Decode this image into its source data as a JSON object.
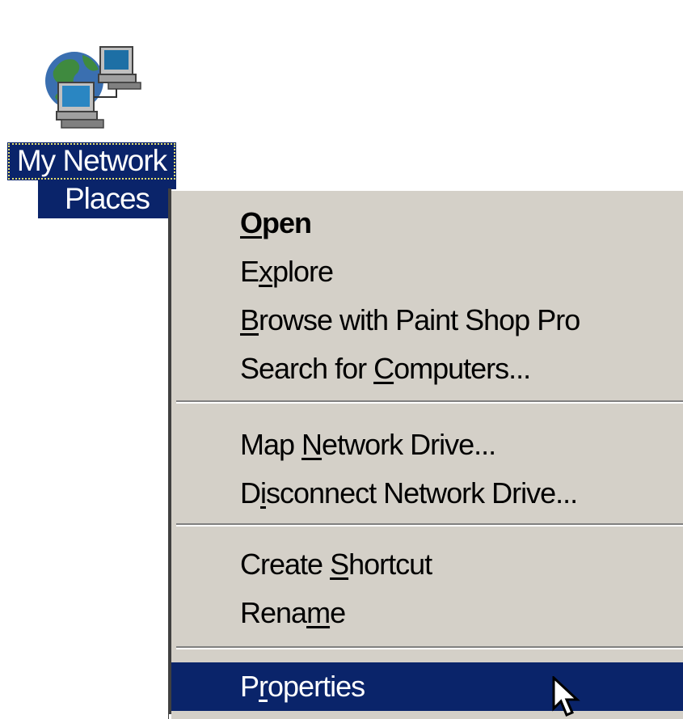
{
  "desktop_icon": {
    "name": "network-places-icon",
    "label_line_1": "My Network",
    "label_line_2": "Places"
  },
  "context_menu": {
    "items": [
      {
        "before": "",
        "accel": "O",
        "after": "pen",
        "bold": true
      },
      {
        "before": "E",
        "accel": "x",
        "after": "plore"
      },
      {
        "before": "",
        "accel": "B",
        "after": "rowse with Paint Shop Pro"
      },
      {
        "before": "Search for ",
        "accel": "C",
        "after": "omputers..."
      },
      {
        "before": "Map ",
        "accel": "N",
        "after": "etwork Drive..."
      },
      {
        "before": "D",
        "accel": "i",
        "after": "sconnect Network Drive..."
      },
      {
        "before": "Create ",
        "accel": "S",
        "after": "hortcut"
      },
      {
        "before": "Rena",
        "accel": "m",
        "after": "e"
      },
      {
        "before": "P",
        "accel": "r",
        "after": "operties",
        "selected": true
      }
    ]
  },
  "colors": {
    "selection": "#0a246a",
    "menu_face": "#d4d0c8",
    "selection_text": "#ffffff"
  },
  "cursor": {
    "name": "arrow-pointer-icon"
  }
}
